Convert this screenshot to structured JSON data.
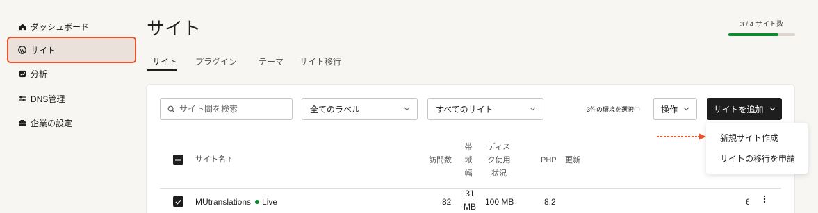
{
  "sidebar": {
    "items": [
      {
        "label": "ダッシュボード",
        "icon": "home-icon"
      },
      {
        "label": "サイト",
        "icon": "wordpress-icon",
        "active": true
      },
      {
        "label": "分析",
        "icon": "analytics-icon"
      },
      {
        "label": "DNS管理",
        "icon": "dns-icon"
      },
      {
        "label": "企業の設定",
        "icon": "briefcase-icon"
      }
    ]
  },
  "header": {
    "title": "サイト",
    "usage": {
      "label": "3 / 4 サイト数",
      "fraction": 0.75,
      "color": "#0c8a2f"
    }
  },
  "tabs": [
    {
      "label": "サイト",
      "active": true
    },
    {
      "label": "プラグイン"
    },
    {
      "label": "テーマ"
    },
    {
      "label": "サイト移行"
    }
  ],
  "toolbar": {
    "search_placeholder": "サイト間を検索",
    "label_filter": "全てのラベル",
    "site_filter": "すべてのサイト",
    "selected_text": "3件の環境を選択中",
    "operations_label": "操作",
    "add_site_label": "サイトを追加"
  },
  "add_menu": {
    "items": [
      "新規サイト作成",
      "サイトの移行を申請"
    ],
    "accent": "#e8542c"
  },
  "table": {
    "headers": {
      "site_name": "サイト名 ↑",
      "visits": "訪問数",
      "bandwidth": [
        "帯",
        "域",
        "幅"
      ],
      "disk": [
        "ディス",
        "ク使用",
        "状況"
      ],
      "php": "PHP",
      "updates": "更新"
    },
    "rows": [
      {
        "name": "MUtranslations",
        "status": "Live",
        "visits": "82",
        "bandwidth": [
          "31",
          "MB"
        ],
        "disk": "100 MB",
        "php": "8.2",
        "trailing": "6"
      }
    ]
  }
}
